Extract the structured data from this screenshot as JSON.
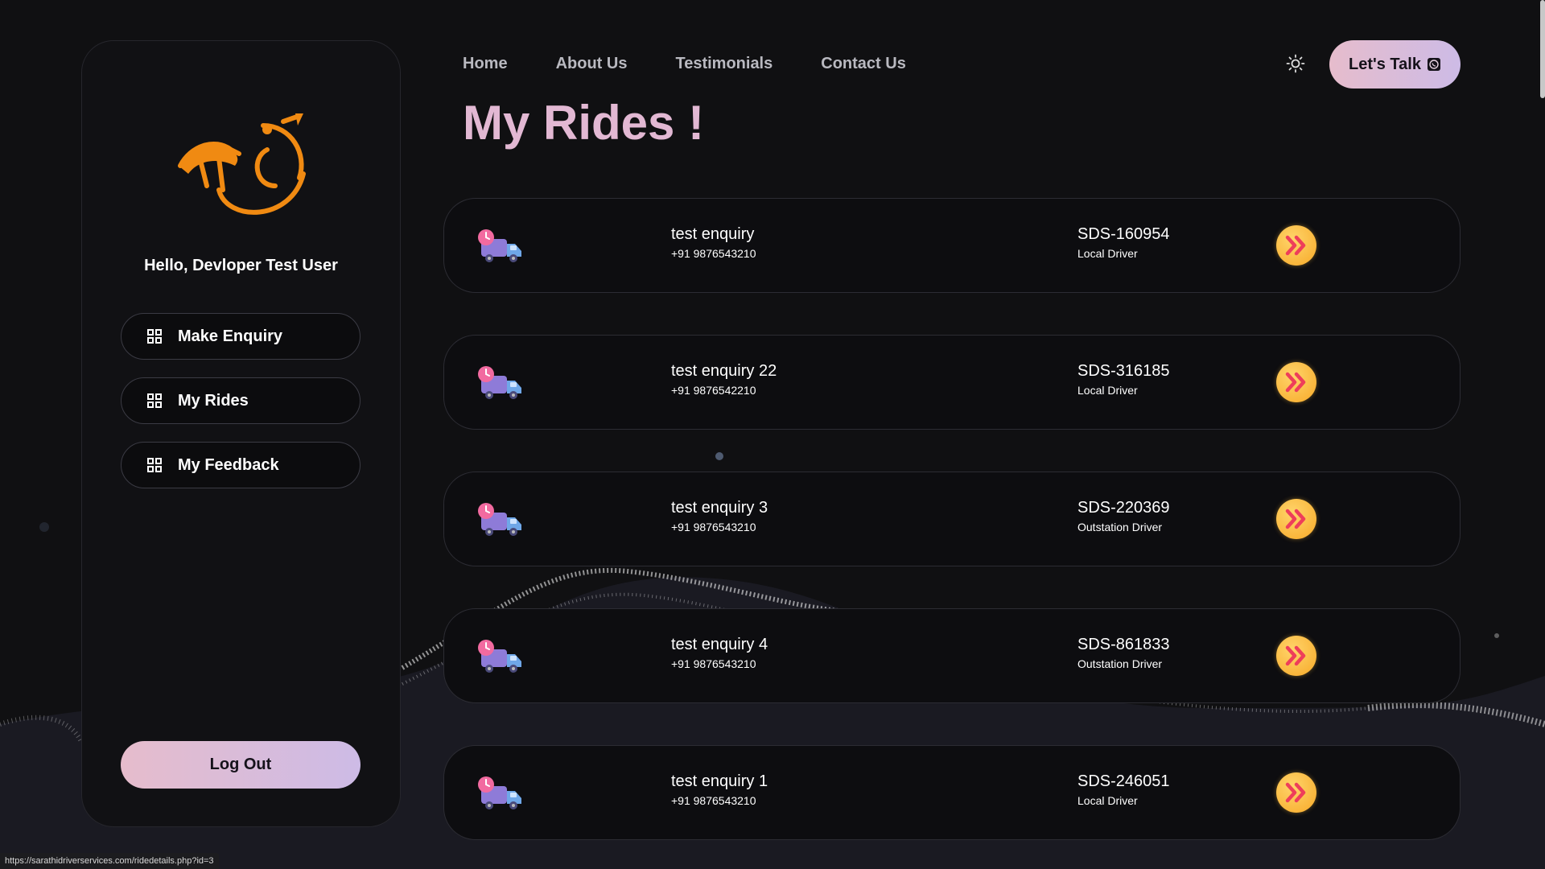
{
  "sidebar": {
    "greeting": "Hello, Devloper Test User",
    "items": [
      {
        "label": "Make Enquiry",
        "icon": "grid-icon"
      },
      {
        "label": "My Rides",
        "icon": "grid-icon"
      },
      {
        "label": "My Feedback",
        "icon": "grid-icon"
      }
    ],
    "logout_label": "Log Out"
  },
  "nav": {
    "links": [
      "Home",
      "About Us",
      "Testimonials",
      "Contact Us"
    ],
    "theme_icon": "sun-icon",
    "talk_label": "Let's Talk",
    "talk_icon": "whatsapp-icon"
  },
  "page": {
    "title": "My Rides !"
  },
  "rides": [
    {
      "name": "test enquiry",
      "phone": "+91 9876543210",
      "code": "SDS-160954",
      "type": "Local Driver"
    },
    {
      "name": "test enquiry 22",
      "phone": "+91 9876542210",
      "code": "SDS-316185",
      "type": "Local Driver"
    },
    {
      "name": "test enquiry 3",
      "phone": "+91 9876543210",
      "code": "SDS-220369",
      "type": "Outstation Driver"
    },
    {
      "name": "test enquiry 4",
      "phone": "+91 9876543210",
      "code": "SDS-861833",
      "type": "Outstation Driver"
    },
    {
      "name": "test enquiry 1",
      "phone": "+91 9876543210",
      "code": "SDS-246051",
      "type": "Local Driver"
    }
  ],
  "status_bar": {
    "url": "https://sarathidriverservices.com/ridedetails.php?id=3"
  },
  "colors": {
    "accent_gradient_start": "#e6bccc",
    "accent_gradient_end": "#cdbbe6",
    "title": "#e2b8d3",
    "logo_orange": "#f08a12",
    "go_button": "#f7a928"
  }
}
